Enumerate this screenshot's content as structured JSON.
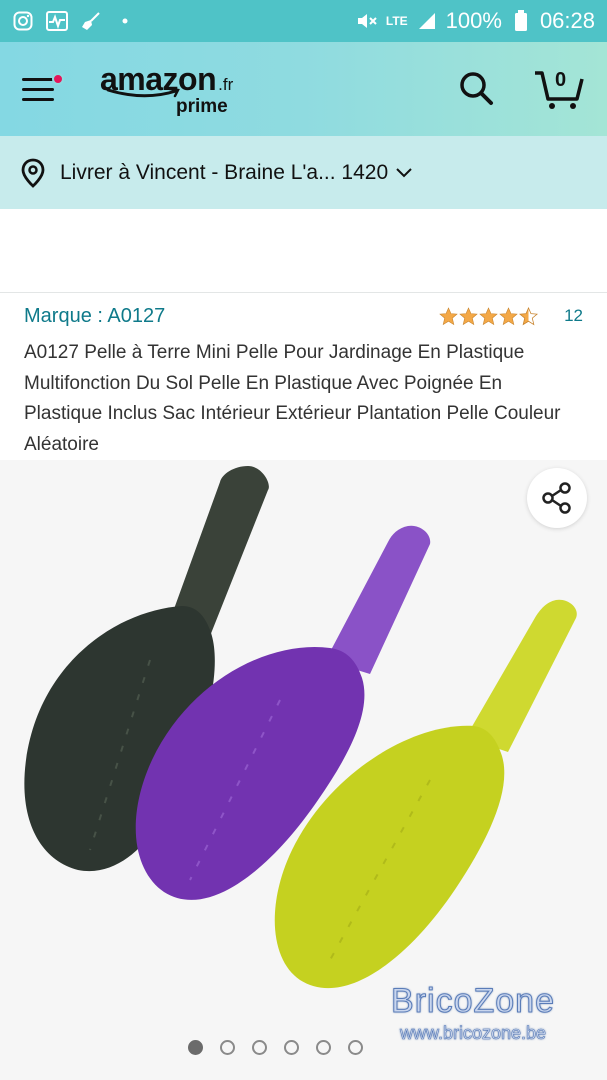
{
  "status_bar": {
    "battery": "100%",
    "time": "06:28",
    "network": "LTE",
    "icons": [
      "instagram-icon",
      "activity-icon",
      "broom-icon",
      "dot-icon",
      "mute-icon",
      "signal-icon",
      "battery-icon"
    ]
  },
  "header": {
    "logo_word": "amazon",
    "logo_tld": ".fr",
    "logo_prime": "prime",
    "cart_count": "0",
    "colors": {
      "accent": "#8fdbe0",
      "notification": "#e3155a"
    }
  },
  "delivery": {
    "text": "Livrer à Vincent - Braine L'a... 1420"
  },
  "product": {
    "brand_label": "Marque : A0127",
    "rating": 4.5,
    "rating_count": "12",
    "title": "A0127 Pelle à Terre Mini Pelle Pour Jardinage En Plastique Multifonction Du Sol Pelle En Plastique Avec Poignée En Plastique Inclus Sac Intérieur Extérieur Plantation Pelle Couleur Aléatoire",
    "link_color": "#0f7a8a",
    "star_color": "#f3a847"
  },
  "gallery": {
    "watermark_title": "BricoZone",
    "watermark_url": "www.bricozone.be",
    "image_count": 6,
    "active_index": 0,
    "scoop_colors": [
      "#2f3a32",
      "#7a3fb3",
      "#c8d42a"
    ]
  }
}
